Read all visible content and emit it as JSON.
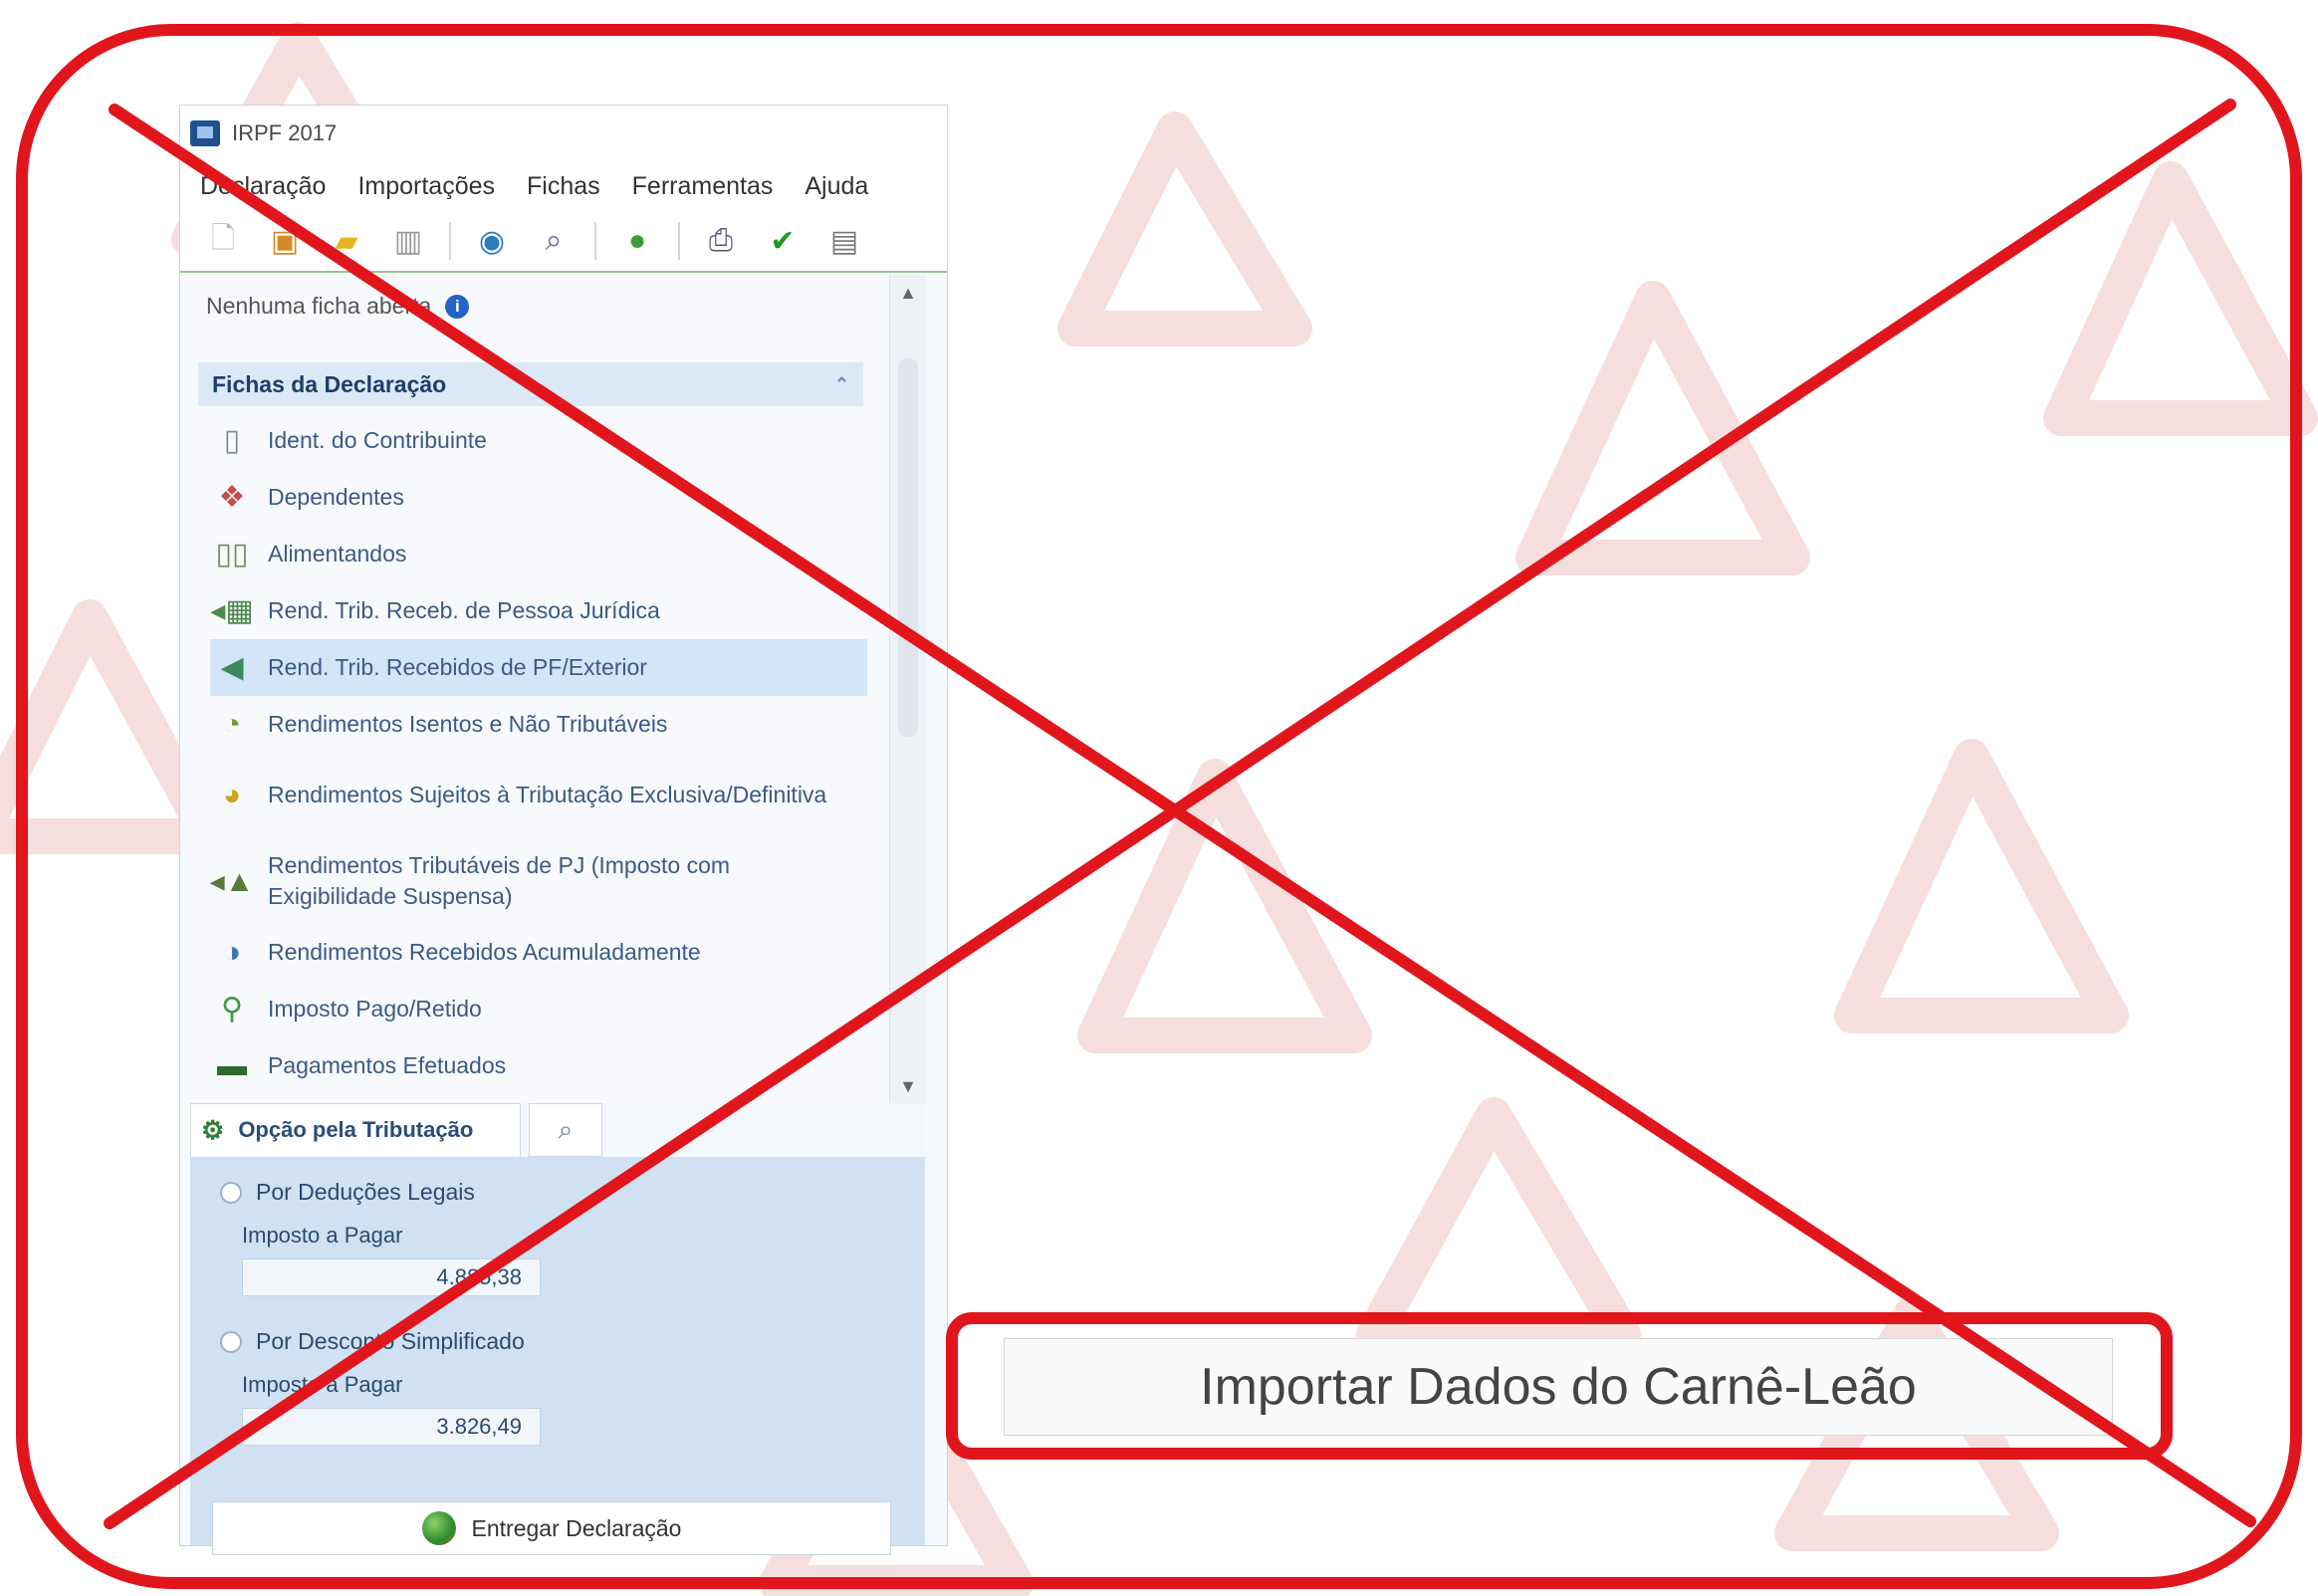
{
  "window": {
    "title": "IRPF 2017",
    "menu": [
      "Declaração",
      "Importações",
      "Fichas",
      "Ferramentas",
      "Ajuda"
    ],
    "toolbar_icons": [
      "new-document-icon",
      "open-icon",
      "folder-icon",
      "trash-icon",
      "globe-icon",
      "search-icon",
      "transmit-icon",
      "print-icon",
      "check-icon",
      "clipboard-icon"
    ]
  },
  "panel": {
    "status_text": "Nenhuma ficha aberta",
    "section_title": "Fichas da Declaração",
    "items": [
      {
        "label": "Ident. do Contribuinte",
        "icon": "contributor-icon"
      },
      {
        "label": "Dependentes",
        "icon": "dependents-icon"
      },
      {
        "label": "Alimentandos",
        "icon": "alimentandos-icon"
      },
      {
        "label": "Rend. Trib. Receb. de Pessoa Jurídica",
        "icon": "income-pj-icon"
      },
      {
        "label": "Rend. Trib. Recebidos de PF/Exterior",
        "icon": "income-pf-icon"
      },
      {
        "label": "Rendimentos Isentos e Não Tributáveis",
        "icon": "exempt-income-icon"
      },
      {
        "label": "Rendimentos Sujeitos à Tributação Exclusiva/Definitiva",
        "icon": "exclusive-tax-icon"
      },
      {
        "label": "Rendimentos Tributáveis de PJ (Imposto com Exigibilidade Suspensa)",
        "icon": "suspended-tax-icon"
      },
      {
        "label": "Rendimentos Recebidos Acumuladamente",
        "icon": "accumulated-income-icon"
      },
      {
        "label": "Imposto Pago/Retido",
        "icon": "tax-paid-icon"
      },
      {
        "label": "Pagamentos Efetuados",
        "icon": "payments-icon"
      }
    ],
    "selected_index": 4
  },
  "tax_option": {
    "tab_label": "Opção pela Tributação",
    "option1": {
      "label": "Por Deduções Legais",
      "sub_label": "Imposto a Pagar",
      "value": "4.885,38"
    },
    "option2": {
      "label": "Por Desconto Simplificado",
      "sub_label": "Imposto a Pagar",
      "value": "3.826,49"
    },
    "deliver_button": "Entregar Declaração"
  },
  "import_button": {
    "label": "Importar Dados do Carnê-Leão"
  },
  "colors": {
    "annotation_red": "#e0161c",
    "selected_row": "#d3e5f8"
  }
}
